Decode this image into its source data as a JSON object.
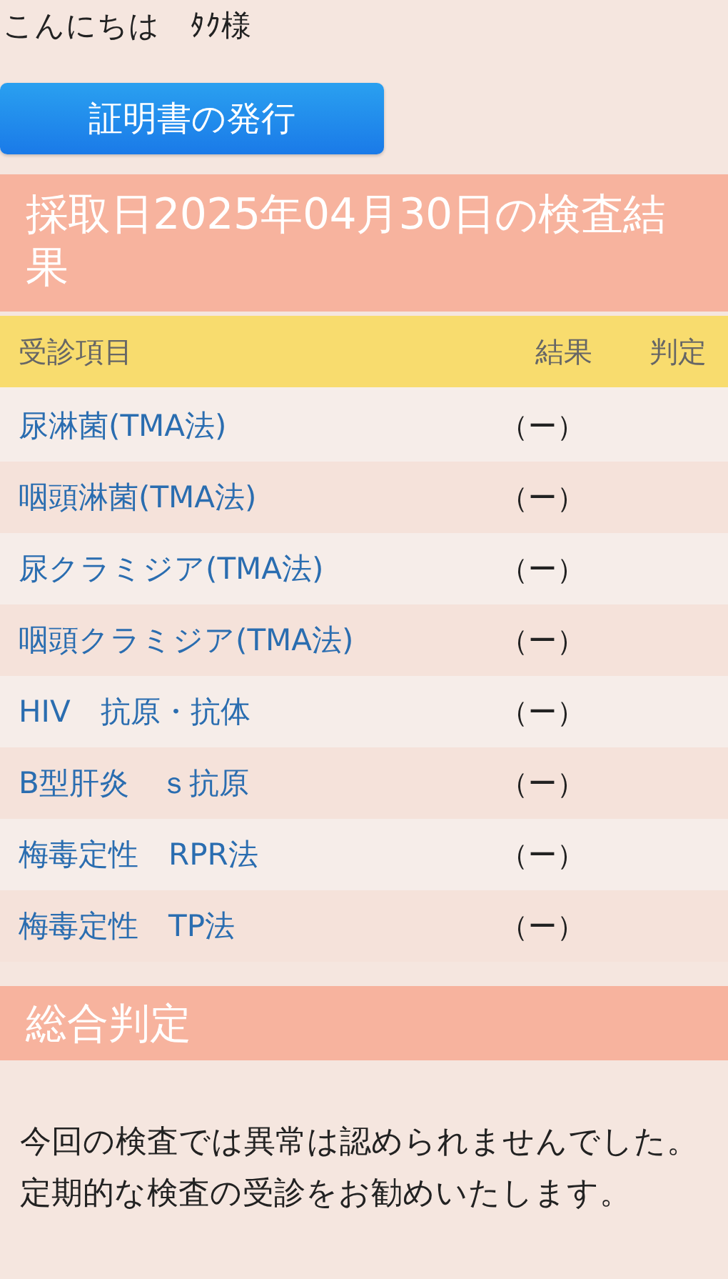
{
  "greeting": "こんにちは　ﾀｸ様",
  "certificate_button": "証明書の発行",
  "results_title": "採取日2025年04月30日の検査結果",
  "table": {
    "columns": [
      "受診項目",
      "結果",
      "判定"
    ],
    "rows": [
      {
        "item": "尿淋菌(TMA法)",
        "result": "（ー）"
      },
      {
        "item": "咽頭淋菌(TMA法)",
        "result": "（ー）"
      },
      {
        "item": "尿クラミジア(TMA法)",
        "result": "（ー）"
      },
      {
        "item": "咽頭クラミジア(TMA法)",
        "result": "（ー）"
      },
      {
        "item": "HIV　抗原・抗体",
        "result": "（ー）"
      },
      {
        "item": "B型肝炎　ｓ抗原",
        "result": "（ー）"
      },
      {
        "item": "梅毒定性　RPR法",
        "result": "（ー）"
      },
      {
        "item": "梅毒定性　TP法",
        "result": "（ー）"
      }
    ]
  },
  "overall_title": "総合判定",
  "overall_text": "今回の検査では異常は認められませんでした。定期的な検査の受診をお勧めいたします。"
}
